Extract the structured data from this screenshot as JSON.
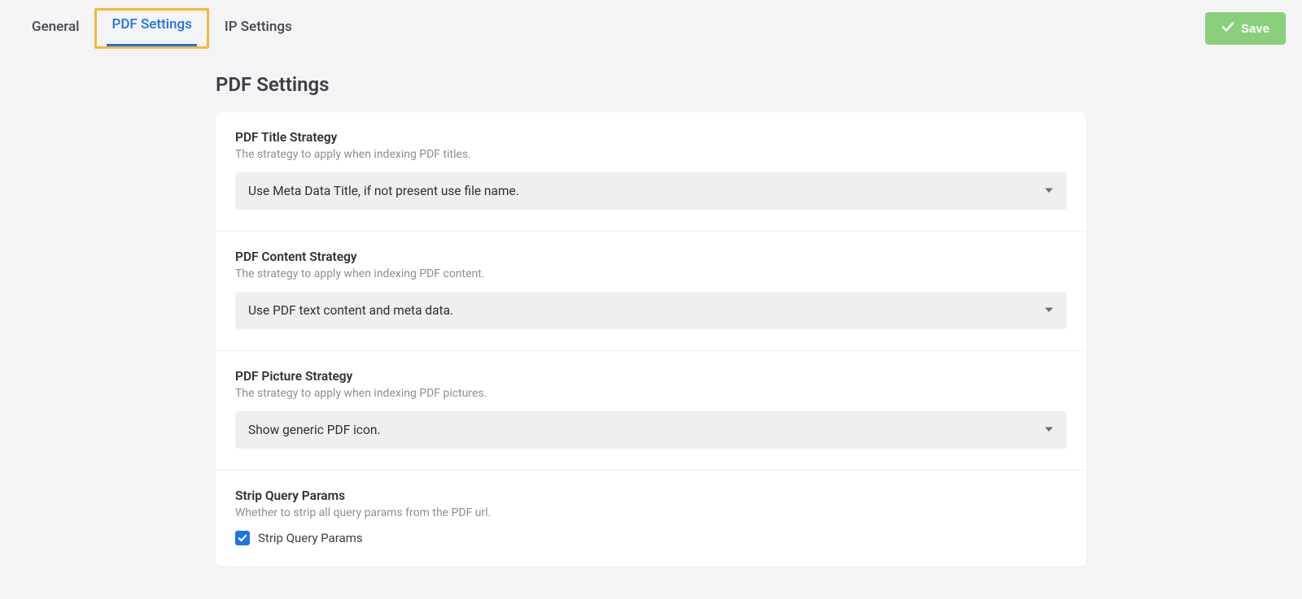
{
  "tabs": {
    "general": "General",
    "pdf_settings": "PDF Settings",
    "ip_settings": "IP Settings"
  },
  "save_button": "Save",
  "page_title": "PDF Settings",
  "sections": {
    "title_strategy": {
      "label": "PDF Title Strategy",
      "desc": "The strategy to apply when indexing PDF titles.",
      "value": "Use Meta Data Title, if not present use file name."
    },
    "content_strategy": {
      "label": "PDF Content Strategy",
      "desc": "The strategy to apply when indexing PDF content.",
      "value": "Use PDF text content and meta data."
    },
    "picture_strategy": {
      "label": "PDF Picture Strategy",
      "desc": "The strategy to apply when indexing PDF pictures.",
      "value": "Show generic PDF icon."
    },
    "strip_query": {
      "label": "Strip Query Params",
      "desc": "Whether to strip all query params from the PDF url.",
      "checkbox_label": "Strip Query Params",
      "checked": true
    }
  }
}
